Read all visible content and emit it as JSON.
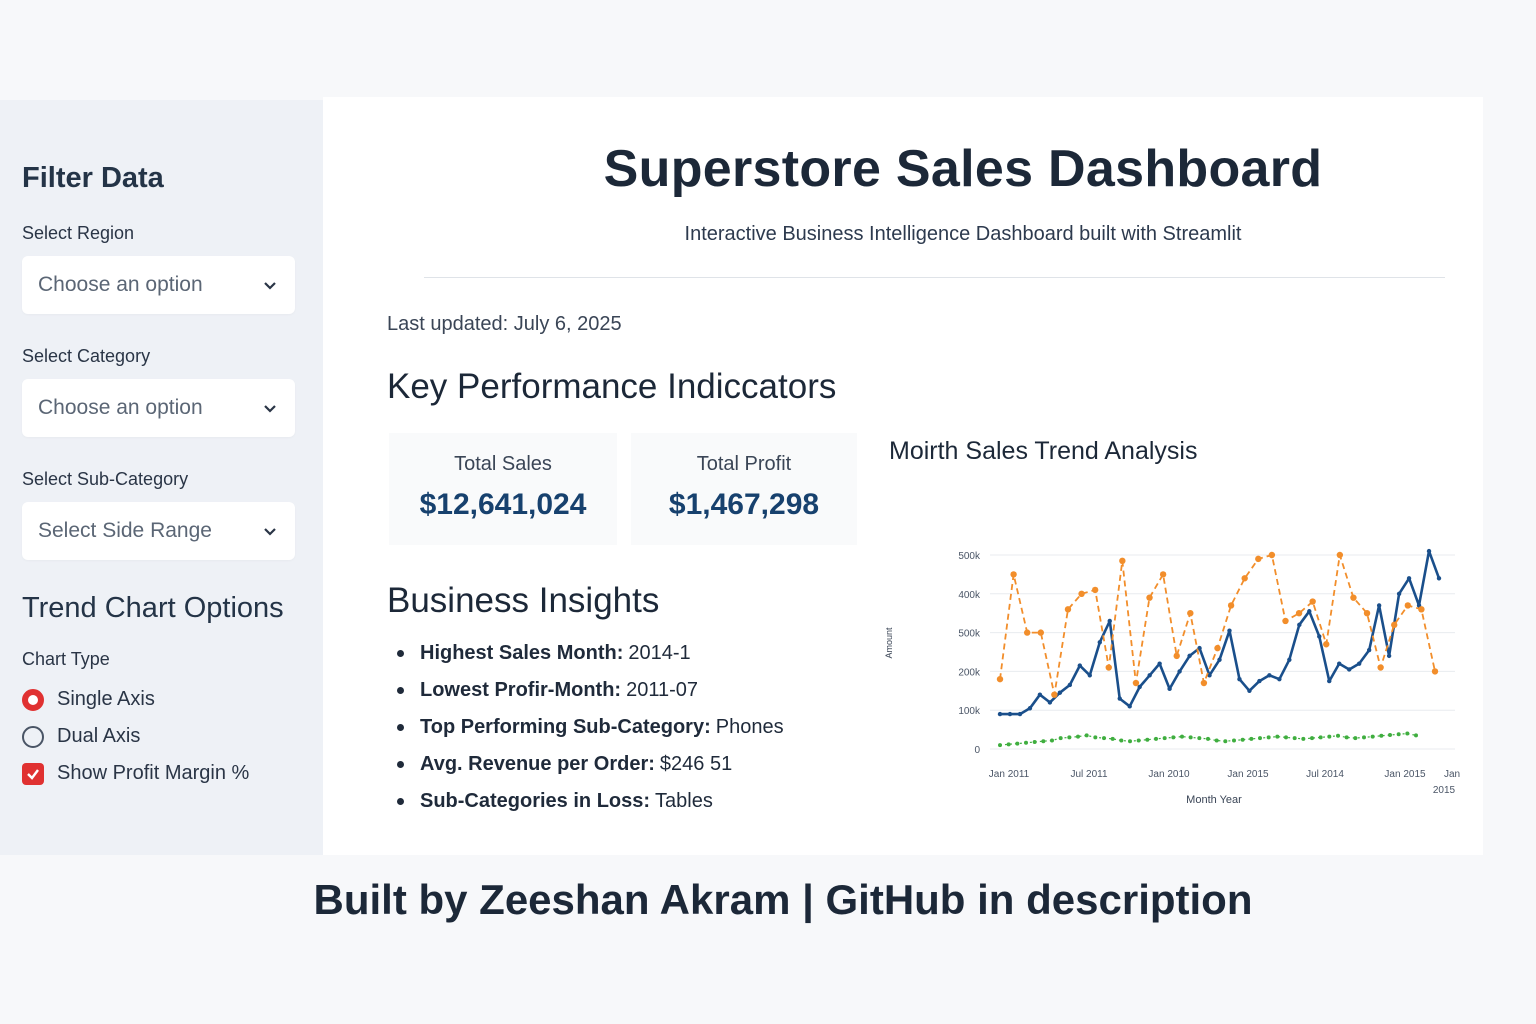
{
  "sidebar": {
    "title": "Filter Data",
    "filters": [
      {
        "label": "Select Region",
        "placeholder": "Choose an option"
      },
      {
        "label": "Select Category",
        "placeholder": "Choose an option"
      },
      {
        "label": "Select Sub-Category",
        "placeholder": "Select Side Range"
      }
    ],
    "trend_title": "Trend Chart Options",
    "chart_type_label": "Chart Type",
    "radio_options": [
      {
        "label": "Single Axis",
        "selected": true
      },
      {
        "label": "Dual Axis",
        "selected": false
      }
    ],
    "checkbox": {
      "label": "Show Profit Margin %",
      "checked": true
    },
    "accent_color": "#e03131"
  },
  "header": {
    "title": "Superstore Sales Dashboard",
    "subtitle": "Interactive Business Intelligence Dashboard built with Streamlit"
  },
  "updated": "Last updated: July 6, 2025",
  "kpi": {
    "heading": "Key Performance Indiccators",
    "cards": [
      {
        "label": "Total Sales",
        "value": "$12,641,024"
      },
      {
        "label": "Total Profit",
        "value": "$1,467,298"
      }
    ]
  },
  "insights": {
    "heading": "Business Insights",
    "items": [
      {
        "key": "Highest Sales Month:",
        "value": "2014-1"
      },
      {
        "key": "Lowest Profir-Month:",
        "value": "2011-07"
      },
      {
        "key": "Top Performing Sub-Category:",
        "value": "Phones"
      },
      {
        "key": "Avg. Revenue per Order:",
        "value": "$246 51"
      },
      {
        "key": "Sub-Categories in Loss:",
        "value": "Tables"
      }
    ]
  },
  "chart": {
    "title": "Moirth Sales Trend Analysis"
  },
  "chart_data": {
    "type": "line",
    "title": "Moirth Sales Trend Analysis",
    "xlabel": "Month Year",
    "ylabel": "Amount",
    "y_ticks": [
      "0",
      "100k",
      "200k",
      "500k",
      "400k",
      "500k"
    ],
    "x_ticks": [
      "Jan 2011",
      "Jul 2011",
      "Jan 2010",
      "Jan 2015",
      "Jul 2014",
      "Jan 2015",
      "Jan 2015"
    ],
    "grid": true,
    "x_count": 48,
    "colors": {
      "sales": "#1a4f8b",
      "orange": "#f28e2b",
      "green": "#3fae3f"
    },
    "series": [
      {
        "values": [
          90,
          90,
          90,
          105,
          140,
          120,
          145,
          165,
          215,
          190,
          275,
          330,
          130,
          110,
          160,
          190,
          220,
          155,
          200,
          240,
          260,
          190,
          230,
          305,
          180,
          150,
          175,
          190,
          180,
          230,
          320,
          355,
          290,
          175,
          220,
          205,
          220,
          255,
          370,
          240,
          400,
          440,
          370,
          510,
          440
        ]
      },
      {
        "values": [
          180,
          450,
          300,
          300,
          140,
          360,
          400,
          410,
          210,
          485,
          170,
          390,
          450,
          240,
          350,
          170,
          260,
          370,
          440,
          490,
          500,
          330,
          350,
          380,
          270,
          500,
          390,
          350,
          210,
          320,
          370,
          360,
          200
        ]
      },
      {
        "values": [
          10,
          12,
          14,
          16,
          18,
          20,
          22,
          28,
          30,
          32,
          35,
          30,
          28,
          26,
          22,
          20,
          22,
          24,
          26,
          28,
          30,
          32,
          30,
          28,
          26,
          22,
          20,
          22,
          24,
          26,
          28,
          30,
          32,
          30,
          28,
          26,
          28,
          30,
          32,
          34,
          30,
          28,
          30,
          32,
          34,
          36,
          38,
          40,
          35
        ]
      }
    ]
  },
  "footer": "Built by Zeeshan Akram | GitHub in description"
}
